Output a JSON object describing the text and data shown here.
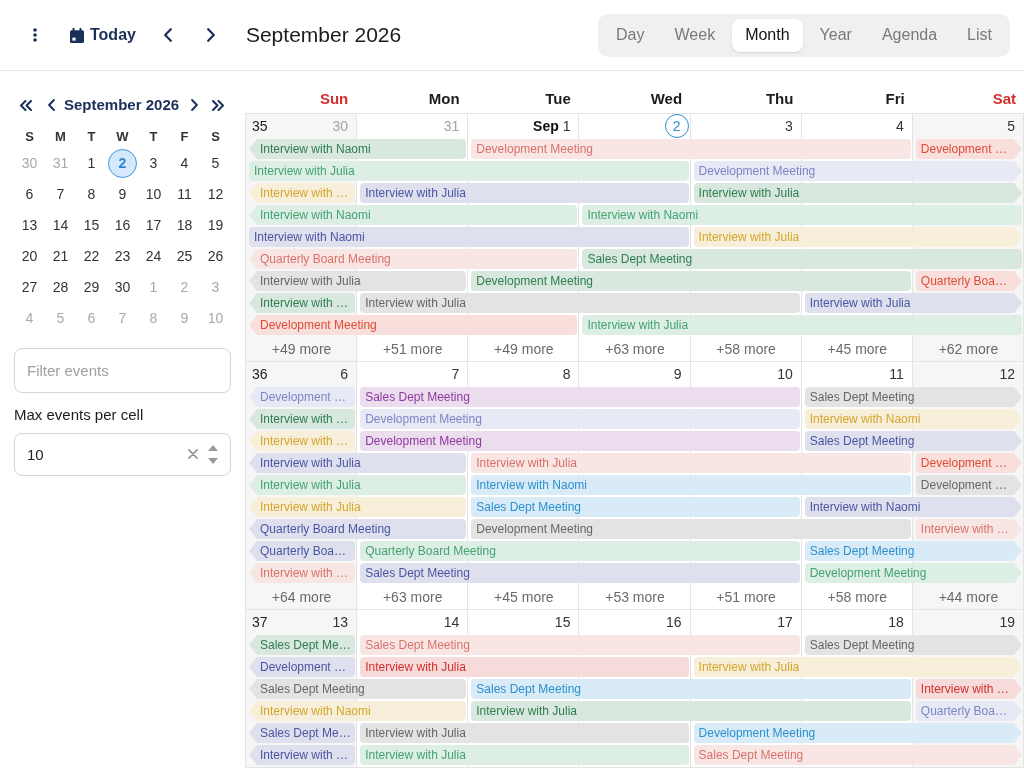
{
  "toolbar": {
    "today": "Today",
    "title": "September 2026",
    "views": [
      {
        "label": "Day",
        "selected": false
      },
      {
        "label": "Week",
        "selected": false
      },
      {
        "label": "Month",
        "selected": true
      },
      {
        "label": "Year",
        "selected": false
      },
      {
        "label": "Agenda",
        "selected": false
      },
      {
        "label": "List",
        "selected": false
      }
    ]
  },
  "mini_calendar": {
    "title": "September 2026",
    "weekdays": [
      "S",
      "M",
      "T",
      "W",
      "T",
      "F",
      "S"
    ],
    "weeks": [
      [
        {
          "label": "30",
          "outside": true,
          "selected": false
        },
        {
          "label": "31",
          "outside": true,
          "selected": false
        },
        {
          "label": "1",
          "outside": false,
          "selected": false
        },
        {
          "label": "2",
          "outside": false,
          "selected": true
        },
        {
          "label": "3",
          "outside": false,
          "selected": false
        },
        {
          "label": "4",
          "outside": false,
          "selected": false
        },
        {
          "label": "5",
          "outside": false,
          "selected": false
        }
      ],
      [
        {
          "label": "6",
          "outside": false,
          "selected": false
        },
        {
          "label": "7",
          "outside": false,
          "selected": false
        },
        {
          "label": "8",
          "outside": false,
          "selected": false
        },
        {
          "label": "9",
          "outside": false,
          "selected": false
        },
        {
          "label": "10",
          "outside": false,
          "selected": false
        },
        {
          "label": "11",
          "outside": false,
          "selected": false
        },
        {
          "label": "12",
          "outside": false,
          "selected": false
        }
      ],
      [
        {
          "label": "13",
          "outside": false,
          "selected": false
        },
        {
          "label": "14",
          "outside": false,
          "selected": false
        },
        {
          "label": "15",
          "outside": false,
          "selected": false
        },
        {
          "label": "16",
          "outside": false,
          "selected": false
        },
        {
          "label": "17",
          "outside": false,
          "selected": false
        },
        {
          "label": "18",
          "outside": false,
          "selected": false
        },
        {
          "label": "19",
          "outside": false,
          "selected": false
        }
      ],
      [
        {
          "label": "20",
          "outside": false,
          "selected": false
        },
        {
          "label": "21",
          "outside": false,
          "selected": false
        },
        {
          "label": "22",
          "outside": false,
          "selected": false
        },
        {
          "label": "23",
          "outside": false,
          "selected": false
        },
        {
          "label": "24",
          "outside": false,
          "selected": false
        },
        {
          "label": "25",
          "outside": false,
          "selected": false
        },
        {
          "label": "26",
          "outside": false,
          "selected": false
        }
      ],
      [
        {
          "label": "27",
          "outside": false,
          "selected": false
        },
        {
          "label": "28",
          "outside": false,
          "selected": false
        },
        {
          "label": "29",
          "outside": false,
          "selected": false
        },
        {
          "label": "30",
          "outside": false,
          "selected": false
        },
        {
          "label": "1",
          "outside": true,
          "selected": false
        },
        {
          "label": "2",
          "outside": true,
          "selected": false
        },
        {
          "label": "3",
          "outside": true,
          "selected": false
        }
      ],
      [
        {
          "label": "4",
          "outside": true,
          "selected": false
        },
        {
          "label": "5",
          "outside": true,
          "selected": false
        },
        {
          "label": "6",
          "outside": true,
          "selected": false
        },
        {
          "label": "7",
          "outside": true,
          "selected": false
        },
        {
          "label": "8",
          "outside": true,
          "selected": false
        },
        {
          "label": "9",
          "outside": true,
          "selected": false
        },
        {
          "label": "10",
          "outside": true,
          "selected": false
        }
      ]
    ]
  },
  "filter": {
    "placeholder": "Filter events"
  },
  "max_events": {
    "label": "Max events per cell",
    "value": "10"
  },
  "month": {
    "weekdays": [
      {
        "label": "Sun",
        "weekend": true
      },
      {
        "label": "Mon",
        "weekend": false
      },
      {
        "label": "Tue",
        "weekend": false
      },
      {
        "label": "Wed",
        "weekend": false
      },
      {
        "label": "Thu",
        "weekend": false
      },
      {
        "label": "Fri",
        "weekend": false
      },
      {
        "label": "Sat",
        "weekend": true
      }
    ],
    "weeks": [
      {
        "number": "35",
        "days": [
          {
            "label": "30",
            "outside": true,
            "today": false,
            "more": "+49 more"
          },
          {
            "label": "31",
            "outside": true,
            "today": false,
            "more": "+51 more"
          },
          {
            "month_label": "Sep",
            "label": "1",
            "outside": false,
            "today": false,
            "more": "+49 more"
          },
          {
            "label": "2",
            "outside": false,
            "today": true,
            "more": "+63 more"
          },
          {
            "label": "3",
            "outside": false,
            "today": false,
            "more": "+58 more"
          },
          {
            "label": "4",
            "outside": false,
            "today": false,
            "more": "+45 more"
          },
          {
            "label": "5",
            "outside": false,
            "today": false,
            "more": "+62 more"
          }
        ],
        "lanes": [
          [
            {
              "kind": "event",
              "title": "Interview with Naomi",
              "color": "#2e7d4f",
              "continues_before": true,
              "continues_after": false
            },
            {
              "kind": "continuation"
            },
            {
              "kind": "event",
              "title": "Development Meeting",
              "color": "#d9726a",
              "continues_before": false,
              "continues_after": false
            },
            {
              "kind": "continuation"
            },
            {
              "kind": "continuation"
            },
            {
              "kind": "continuation"
            },
            {
              "kind": "event",
              "title": "Development …",
              "color": "#de4b37",
              "continues_before": false,
              "continues_after": true
            }
          ],
          [
            {
              "kind": "event",
              "title": "Interview with Julia",
              "color": "#43a371",
              "continues_before": false,
              "continues_after": false
            },
            {
              "kind": "continuation"
            },
            {
              "kind": "continuation"
            },
            {
              "kind": "continuation"
            },
            {
              "kind": "event",
              "title": "Development Meeting",
              "color": "#7c86c6",
              "continues_before": false,
              "continues_after": true
            },
            {
              "kind": "continuation"
            },
            {
              "kind": "continuation"
            }
          ],
          [
            {
              "kind": "event",
              "title": "Interview with …",
              "color": "#d4a52c",
              "continues_before": true,
              "continues_after": false
            },
            {
              "kind": "event",
              "title": "Interview with Julia",
              "color": "#4a55a2",
              "continues_before": false,
              "continues_after": false
            },
            {
              "kind": "continuation"
            },
            {
              "kind": "continuation"
            },
            {
              "kind": "event",
              "title": "Interview with Julia",
              "color": "#2e7d4f",
              "continues_before": false,
              "continues_after": true
            },
            {
              "kind": "continuation"
            },
            {
              "kind": "continuation"
            }
          ],
          [
            {
              "kind": "event",
              "title": "Interview with Naomi",
              "color": "#43a371",
              "continues_before": true,
              "continues_after": false
            },
            {
              "kind": "continuation"
            },
            {
              "kind": "continuation"
            },
            {
              "kind": "event",
              "title": "Interview with Naomi",
              "color": "#43a371",
              "continues_before": false,
              "continues_after": false
            },
            {
              "kind": "continuation"
            },
            {
              "kind": "continuation"
            },
            {
              "kind": "continuation"
            }
          ],
          [
            {
              "kind": "event",
              "title": "Interview with Naomi",
              "color": "#4a55a2",
              "continues_before": false,
              "continues_after": false
            },
            {
              "kind": "continuation"
            },
            {
              "kind": "continuation"
            },
            {
              "kind": "continuation"
            },
            {
              "kind": "event",
              "title": "Interview with Julia",
              "color": "#d4a52c",
              "continues_before": false,
              "continues_after": true
            },
            {
              "kind": "continuation"
            },
            {
              "kind": "continuation"
            }
          ],
          [
            {
              "kind": "event",
              "title": "Quarterly Board Meeting",
              "color": "#d9726a",
              "continues_before": true,
              "continues_after": false
            },
            {
              "kind": "continuation"
            },
            {
              "kind": "continuation"
            },
            {
              "kind": "event",
              "title": "Sales Dept Meeting",
              "color": "#2e7d4f",
              "continues_before": false,
              "continues_after": false
            },
            {
              "kind": "continuation"
            },
            {
              "kind": "continuation"
            },
            {
              "kind": "continuation"
            }
          ],
          [
            {
              "kind": "event",
              "title": "Interview with Julia",
              "color": "#666666",
              "continues_before": true,
              "continues_after": false
            },
            {
              "kind": "continuation"
            },
            {
              "kind": "event",
              "title": "Development Meeting",
              "color": "#2e7d4f",
              "continues_before": false,
              "continues_after": false
            },
            {
              "kind": "continuation"
            },
            {
              "kind": "continuation"
            },
            {
              "kind": "continuation"
            },
            {
              "kind": "event",
              "title": "Quarterly Boa…",
              "color": "#de4b37",
              "continues_before": false,
              "continues_after": true
            }
          ],
          [
            {
              "kind": "event",
              "title": "Interview with …",
              "color": "#2e7d4f",
              "continues_before": true,
              "continues_after": false
            },
            {
              "kind": "event",
              "title": "Interview with Julia",
              "color": "#666666",
              "continues_before": false,
              "continues_after": false
            },
            {
              "kind": "continuation"
            },
            {
              "kind": "continuation"
            },
            {
              "kind": "continuation"
            },
            {
              "kind": "event",
              "title": "Interview with Julia",
              "color": "#4a55a2",
              "continues_before": false,
              "continues_after": true
            },
            {
              "kind": "continuation"
            }
          ],
          [
            {
              "kind": "event",
              "title": "Development Meeting",
              "color": "#de4b37",
              "continues_before": true,
              "continues_after": false
            },
            {
              "kind": "continuation"
            },
            {
              "kind": "continuation"
            },
            {
              "kind": "event",
              "title": "Interview with Julia",
              "color": "#43a371",
              "continues_before": false,
              "continues_after": false
            },
            {
              "kind": "continuation"
            },
            {
              "kind": "continuation"
            },
            {
              "kind": "continuation"
            }
          ]
        ]
      },
      {
        "number": "36",
        "days": [
          {
            "label": "6",
            "outside": false,
            "today": false,
            "more": "+64 more"
          },
          {
            "label": "7",
            "outside": false,
            "today": false,
            "more": "+63 more"
          },
          {
            "label": "8",
            "outside": false,
            "today": false,
            "more": "+45 more"
          },
          {
            "label": "9",
            "outside": false,
            "today": false,
            "more": "+53 more"
          },
          {
            "label": "10",
            "outside": false,
            "today": false,
            "more": "+51 more"
          },
          {
            "label": "11",
            "outside": false,
            "today": false,
            "more": "+58 more"
          },
          {
            "label": "12",
            "outside": false,
            "today": false,
            "more": "+44 more"
          }
        ],
        "lanes": [
          [
            {
              "kind": "event",
              "title": "Development …",
              "color": "#7c86c6",
              "continues_before": true,
              "continues_after": false
            },
            {
              "kind": "event",
              "title": "Sales Dept Meeting",
              "color": "#8e3aa0",
              "continues_before": false,
              "continues_after": false
            },
            {
              "kind": "continuation"
            },
            {
              "kind": "continuation"
            },
            {
              "kind": "continuation"
            },
            {
              "kind": "event",
              "title": "Sales Dept Meeting",
              "color": "#666666",
              "continues_before": false,
              "continues_after": true
            },
            {
              "kind": "continuation"
            }
          ],
          [
            {
              "kind": "event",
              "title": "Interview with …",
              "color": "#2e7d4f",
              "continues_before": true,
              "continues_after": false
            },
            {
              "kind": "event",
              "title": "Development Meeting",
              "color": "#7c86c6",
              "continues_before": false,
              "continues_after": false
            },
            {
              "kind": "continuation"
            },
            {
              "kind": "continuation"
            },
            {
              "kind": "continuation"
            },
            {
              "kind": "event",
              "title": "Interview with Naomi",
              "color": "#d4a52c",
              "continues_before": false,
              "continues_after": true
            },
            {
              "kind": "continuation"
            }
          ],
          [
            {
              "kind": "event",
              "title": "Interview with …",
              "color": "#d4a52c",
              "continues_before": true,
              "continues_after": false
            },
            {
              "kind": "event",
              "title": "Development Meeting",
              "color": "#8e3aa0",
              "continues_before": false,
              "continues_after": false
            },
            {
              "kind": "continuation"
            },
            {
              "kind": "continuation"
            },
            {
              "kind": "continuation"
            },
            {
              "kind": "event",
              "title": "Sales Dept Meeting",
              "color": "#4a55a2",
              "continues_before": false,
              "continues_after": true
            },
            {
              "kind": "continuation"
            }
          ],
          [
            {
              "kind": "event",
              "title": "Interview with Julia",
              "color": "#4a55a2",
              "continues_before": true,
              "continues_after": false
            },
            {
              "kind": "continuation"
            },
            {
              "kind": "event",
              "title": "Interview with Julia",
              "color": "#d9726a",
              "continues_before": false,
              "continues_after": false
            },
            {
              "kind": "continuation"
            },
            {
              "kind": "continuation"
            },
            {
              "kind": "continuation"
            },
            {
              "kind": "event",
              "title": "Development …",
              "color": "#de4b37",
              "continues_before": false,
              "continues_after": true
            }
          ],
          [
            {
              "kind": "event",
              "title": "Interview with Julia",
              "color": "#43a371",
              "continues_before": true,
              "continues_after": false
            },
            {
              "kind": "continuation"
            },
            {
              "kind": "event",
              "title": "Interview with Naomi",
              "color": "#2b90d0",
              "continues_before": false,
              "continues_after": false
            },
            {
              "kind": "continuation"
            },
            {
              "kind": "continuation"
            },
            {
              "kind": "continuation"
            },
            {
              "kind": "event",
              "title": "Development …",
              "color": "#666666",
              "continues_before": false,
              "continues_after": true
            }
          ],
          [
            {
              "kind": "event",
              "title": "Interview with Julia",
              "color": "#d4a52c",
              "continues_before": true,
              "continues_after": false
            },
            {
              "kind": "continuation"
            },
            {
              "kind": "event",
              "title": "Sales Dept Meeting",
              "color": "#2b90d0",
              "continues_before": false,
              "continues_after": false
            },
            {
              "kind": "continuation"
            },
            {
              "kind": "continuation"
            },
            {
              "kind": "event",
              "title": "Interview with Naomi",
              "color": "#4a55a2",
              "continues_before": false,
              "continues_after": true
            },
            {
              "kind": "continuation"
            }
          ],
          [
            {
              "kind": "event",
              "title": "Quarterly Board Meeting",
              "color": "#4a55a2",
              "continues_before": true,
              "continues_after": false
            },
            {
              "kind": "continuation"
            },
            {
              "kind": "event",
              "title": "Development Meeting",
              "color": "#666666",
              "continues_before": false,
              "continues_after": false
            },
            {
              "kind": "continuation"
            },
            {
              "kind": "continuation"
            },
            {
              "kind": "continuation"
            },
            {
              "kind": "event",
              "title": "Interview with …",
              "color": "#d9726a",
              "continues_before": false,
              "continues_after": true
            }
          ],
          [
            {
              "kind": "event",
              "title": "Quarterly Boa…",
              "color": "#4a55a2",
              "continues_before": true,
              "continues_after": false
            },
            {
              "kind": "event",
              "title": "Quarterly Board Meeting",
              "color": "#43a371",
              "continues_before": false,
              "continues_after": false
            },
            {
              "kind": "continuation"
            },
            {
              "kind": "continuation"
            },
            {
              "kind": "continuation"
            },
            {
              "kind": "event",
              "title": "Sales Dept Meeting",
              "color": "#2b90d0",
              "continues_before": false,
              "continues_after": true
            },
            {
              "kind": "continuation"
            }
          ],
          [
            {
              "kind": "event",
              "title": "Interview with …",
              "color": "#d9726a",
              "continues_before": true,
              "continues_after": false
            },
            {
              "kind": "event",
              "title": "Sales Dept Meeting",
              "color": "#4a55a2",
              "continues_before": false,
              "continues_after": false
            },
            {
              "kind": "continuation"
            },
            {
              "kind": "continuation"
            },
            {
              "kind": "continuation"
            },
            {
              "kind": "event",
              "title": "Development Meeting",
              "color": "#43a371",
              "continues_before": false,
              "continues_after": true
            },
            {
              "kind": "continuation"
            }
          ]
        ]
      },
      {
        "number": "37",
        "days": [
          {
            "label": "13",
            "outside": false,
            "today": false
          },
          {
            "label": "14",
            "outside": false,
            "today": false
          },
          {
            "label": "15",
            "outside": false,
            "today": false
          },
          {
            "label": "16",
            "outside": false,
            "today": false
          },
          {
            "label": "17",
            "outside": false,
            "today": false
          },
          {
            "label": "18",
            "outside": false,
            "today": false
          },
          {
            "label": "19",
            "outside": false,
            "today": false
          }
        ],
        "lanes": [
          [
            {
              "kind": "event",
              "title": "Sales Dept Me…",
              "color": "#2e7d4f",
              "continues_before": true,
              "continues_after": false
            },
            {
              "kind": "event",
              "title": "Sales Dept Meeting",
              "color": "#d9726a",
              "continues_before": false,
              "continues_after": false
            },
            {
              "kind": "continuation"
            },
            {
              "kind": "continuation"
            },
            {
              "kind": "continuation"
            },
            {
              "kind": "event",
              "title": "Sales Dept Meeting",
              "color": "#666666",
              "continues_before": false,
              "continues_after": true
            },
            {
              "kind": "continuation"
            }
          ],
          [
            {
              "kind": "event",
              "title": "Development …",
              "color": "#4a55a2",
              "continues_before": true,
              "continues_after": false
            },
            {
              "kind": "event",
              "title": "Interview with Julia",
              "color": "#d32f2f",
              "continues_before": false,
              "continues_after": false
            },
            {
              "kind": "continuation"
            },
            {
              "kind": "continuation"
            },
            {
              "kind": "event",
              "title": "Interview with Julia",
              "color": "#d4a52c",
              "continues_before": false,
              "continues_after": true
            },
            {
              "kind": "continuation"
            },
            {
              "kind": "continuation"
            }
          ],
          [
            {
              "kind": "event",
              "title": "Sales Dept Meeting",
              "color": "#666666",
              "continues_before": true,
              "continues_after": false
            },
            {
              "kind": "continuation"
            },
            {
              "kind": "event",
              "title": "Sales Dept Meeting",
              "color": "#2b90d0",
              "continues_before": false,
              "continues_after": false
            },
            {
              "kind": "continuation"
            },
            {
              "kind": "continuation"
            },
            {
              "kind": "continuation"
            },
            {
              "kind": "event",
              "title": "Interview with …",
              "color": "#d32f2f",
              "continues_before": false,
              "continues_after": true
            }
          ],
          [
            {
              "kind": "event",
              "title": "Interview with Naomi",
              "color": "#d4a52c",
              "continues_before": true,
              "continues_after": false
            },
            {
              "kind": "continuation"
            },
            {
              "kind": "event",
              "title": "Interview with Julia",
              "color": "#2e7d4f",
              "continues_before": false,
              "continues_after": false
            },
            {
              "kind": "continuation"
            },
            {
              "kind": "continuation"
            },
            {
              "kind": "continuation"
            },
            {
              "kind": "event",
              "title": "Quarterly Boa…",
              "color": "#7c86c6",
              "continues_before": false,
              "continues_after": true
            }
          ],
          [
            {
              "kind": "event",
              "title": "Sales Dept Me…",
              "color": "#4a55a2",
              "continues_before": true,
              "continues_after": false
            },
            {
              "kind": "event",
              "title": "Interview with Julia",
              "color": "#666666",
              "continues_before": false,
              "continues_after": false
            },
            {
              "kind": "continuation"
            },
            {
              "kind": "continuation"
            },
            {
              "kind": "event",
              "title": "Development Meeting",
              "color": "#2b90d0",
              "continues_before": false,
              "continues_after": true
            },
            {
              "kind": "continuation"
            },
            {
              "kind": "continuation"
            }
          ],
          [
            {
              "kind": "event",
              "title": "Interview with …",
              "color": "#4a55a2",
              "continues_before": true,
              "continues_after": false
            },
            {
              "kind": "event",
              "title": "Interview with Julia",
              "color": "#43a371",
              "continues_before": false,
              "continues_after": false
            },
            {
              "kind": "continuation"
            },
            {
              "kind": "continuation"
            },
            {
              "kind": "event",
              "title": "Sales Dept Meeting",
              "color": "#d9726a",
              "continues_before": false,
              "continues_after": true
            },
            {
              "kind": "continuation"
            },
            {
              "kind": "continuation"
            }
          ]
        ]
      }
    ]
  }
}
